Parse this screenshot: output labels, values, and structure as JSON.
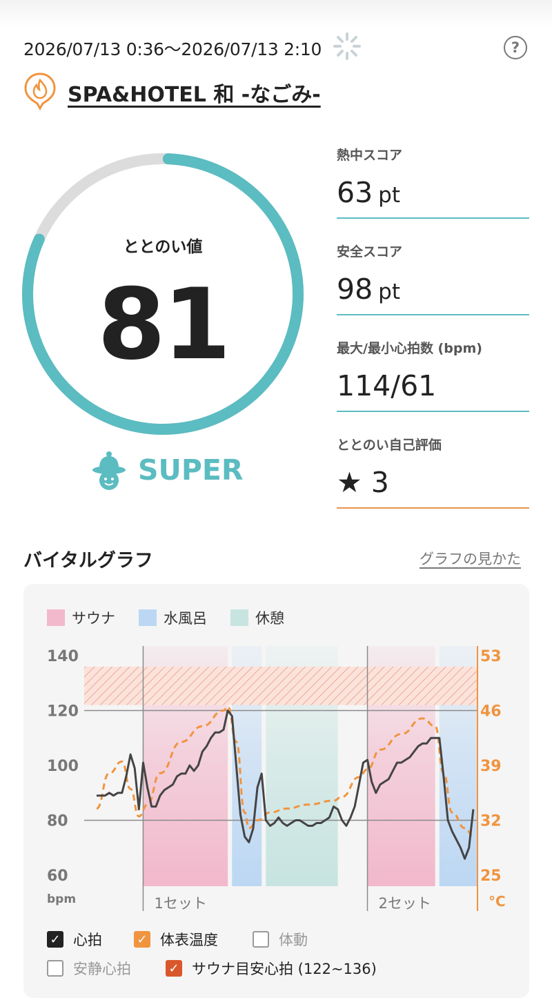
{
  "session": {
    "datetime": "2026/07/13 0:36～2026/07/13 2:10",
    "facility_name": "SPA&HOTEL 和 -なごみ-",
    "help_icon": "question-circle-icon"
  },
  "totonoi": {
    "label": "ととのい値",
    "value": "81",
    "score_fraction": 0.81,
    "level": "SUPER",
    "accent_color": "#5bbcc1"
  },
  "stats": [
    {
      "label": "熱中スコア",
      "value": "63",
      "unit": "pt"
    },
    {
      "label": "安全スコア",
      "value": "98",
      "unit": "pt"
    },
    {
      "label": "最大/最小心拍数 (bpm)",
      "value": "114/61",
      "unit": ""
    },
    {
      "label": "ととのい自己評価",
      "value": "★ 3",
      "unit": ""
    }
  ],
  "vital": {
    "section_title": "バイタルグラフ",
    "help_link": "グラフの見かた",
    "legend": [
      {
        "label": "サウナ",
        "color": "#f2b8cb"
      },
      {
        "label": "水風呂",
        "color": "#bcd7f3"
      },
      {
        "label": "休憩",
        "color": "#c7e4e0"
      }
    ],
    "toggles": [
      {
        "label": "心拍",
        "checked": true,
        "color": "#222222"
      },
      {
        "label": "体表温度",
        "checked": true,
        "color": "#f0943f"
      },
      {
        "label": "体動",
        "checked": false,
        "color": "#999999"
      },
      {
        "label": "安静心拍",
        "checked": false,
        "color": "#999999"
      },
      {
        "label": "サウナ目安心拍 (122~136)",
        "checked": true,
        "color": "#d9582b"
      }
    ]
  },
  "chart_data": {
    "type": "line",
    "y_left": {
      "label": "bpm",
      "ticks": [
        "140",
        "120",
        "100",
        "80",
        "60"
      ],
      "range": [
        60,
        140
      ]
    },
    "y_right": {
      "label": "°C",
      "ticks": [
        "53",
        "46",
        "39",
        "32",
        "25"
      ],
      "range": [
        25,
        53
      ]
    },
    "x_labels": [
      "1セット",
      "2セット"
    ],
    "target_band": [
      122,
      136
    ],
    "phases": [
      {
        "type": "sauna",
        "start_min": 11,
        "end_min": 31
      },
      {
        "type": "cold",
        "start_min": 32,
        "end_min": 39
      },
      {
        "type": "rest",
        "start_min": 40,
        "end_min": 57
      },
      {
        "type": "sauna",
        "start_min": 64,
        "end_min": 80
      },
      {
        "type": "cold",
        "start_min": 81,
        "end_min": 90
      }
    ],
    "series": [
      {
        "name": "心拍",
        "color": "#444444",
        "points": [
          [
            0,
            89
          ],
          [
            1,
            89
          ],
          [
            2,
            89
          ],
          [
            3,
            90
          ],
          [
            4,
            89
          ],
          [
            5,
            90
          ],
          [
            6,
            90
          ],
          [
            7,
            96
          ],
          [
            8,
            104
          ],
          [
            9,
            99
          ],
          [
            10,
            84
          ],
          [
            11,
            101
          ],
          [
            12,
            92
          ],
          [
            13,
            85
          ],
          [
            14,
            85
          ],
          [
            15,
            89
          ],
          [
            16,
            91
          ],
          [
            17,
            92
          ],
          [
            18,
            93
          ],
          [
            19,
            96
          ],
          [
            20,
            97
          ],
          [
            21,
            97
          ],
          [
            22,
            100
          ],
          [
            23,
            98
          ],
          [
            24,
            100
          ],
          [
            25,
            105
          ],
          [
            26,
            107
          ],
          [
            27,
            110
          ],
          [
            28,
            112
          ],
          [
            29,
            112
          ],
          [
            30,
            113
          ],
          [
            31,
            120
          ],
          [
            32,
            118
          ],
          [
            33,
            100
          ],
          [
            34,
            82
          ],
          [
            35,
            74
          ],
          [
            36,
            72
          ],
          [
            37,
            77
          ],
          [
            38,
            92
          ],
          [
            39,
            97
          ],
          [
            40,
            80
          ],
          [
            41,
            78
          ],
          [
            42,
            79
          ],
          [
            43,
            81
          ],
          [
            44,
            79
          ],
          [
            45,
            78
          ],
          [
            46,
            79
          ],
          [
            47,
            80
          ],
          [
            48,
            80
          ],
          [
            49,
            79
          ],
          [
            50,
            78
          ],
          [
            51,
            78
          ],
          [
            52,
            79
          ],
          [
            53,
            79
          ],
          [
            54,
            80
          ],
          [
            55,
            81
          ],
          [
            56,
            85
          ],
          [
            57,
            84
          ],
          [
            58,
            80
          ],
          [
            59,
            78
          ],
          [
            60,
            81
          ],
          [
            61,
            85
          ],
          [
            62,
            93
          ],
          [
            63,
            101
          ],
          [
            64,
            102
          ],
          [
            65,
            94
          ],
          [
            66,
            90
          ],
          [
            67,
            93
          ],
          [
            68,
            94
          ],
          [
            69,
            95
          ],
          [
            70,
            98
          ],
          [
            71,
            101
          ],
          [
            72,
            101
          ],
          [
            73,
            102
          ],
          [
            74,
            103
          ],
          [
            75,
            105
          ],
          [
            76,
            107
          ],
          [
            77,
            108
          ],
          [
            78,
            108
          ],
          [
            79,
            110
          ],
          [
            80,
            110
          ],
          [
            81,
            110
          ],
          [
            82,
            96
          ],
          [
            83,
            80
          ],
          [
            84,
            76
          ],
          [
            85,
            73
          ],
          [
            86,
            70
          ],
          [
            87,
            66
          ],
          [
            88,
            70
          ],
          [
            89,
            84
          ]
        ]
      },
      {
        "name": "体表温度",
        "color": "#f0943f",
        "points": [
          [
            0,
            33.5
          ],
          [
            3,
            38
          ],
          [
            6,
            39.5
          ],
          [
            8,
            36
          ],
          [
            10,
            32.5
          ],
          [
            12,
            34
          ],
          [
            15,
            38
          ],
          [
            20,
            42
          ],
          [
            25,
            44
          ],
          [
            30,
            46
          ],
          [
            31,
            46.5
          ],
          [
            33,
            42
          ],
          [
            35,
            33
          ],
          [
            36,
            31
          ],
          [
            38,
            32
          ],
          [
            41,
            33
          ],
          [
            45,
            33.5
          ],
          [
            50,
            34
          ],
          [
            56,
            34.5
          ],
          [
            58,
            35
          ],
          [
            62,
            37.5
          ],
          [
            64,
            38.5
          ],
          [
            67,
            41
          ],
          [
            72,
            43
          ],
          [
            77,
            45
          ],
          [
            80,
            44
          ],
          [
            82,
            38
          ],
          [
            84,
            33
          ],
          [
            87,
            31
          ],
          [
            89,
            30
          ]
        ]
      }
    ]
  }
}
